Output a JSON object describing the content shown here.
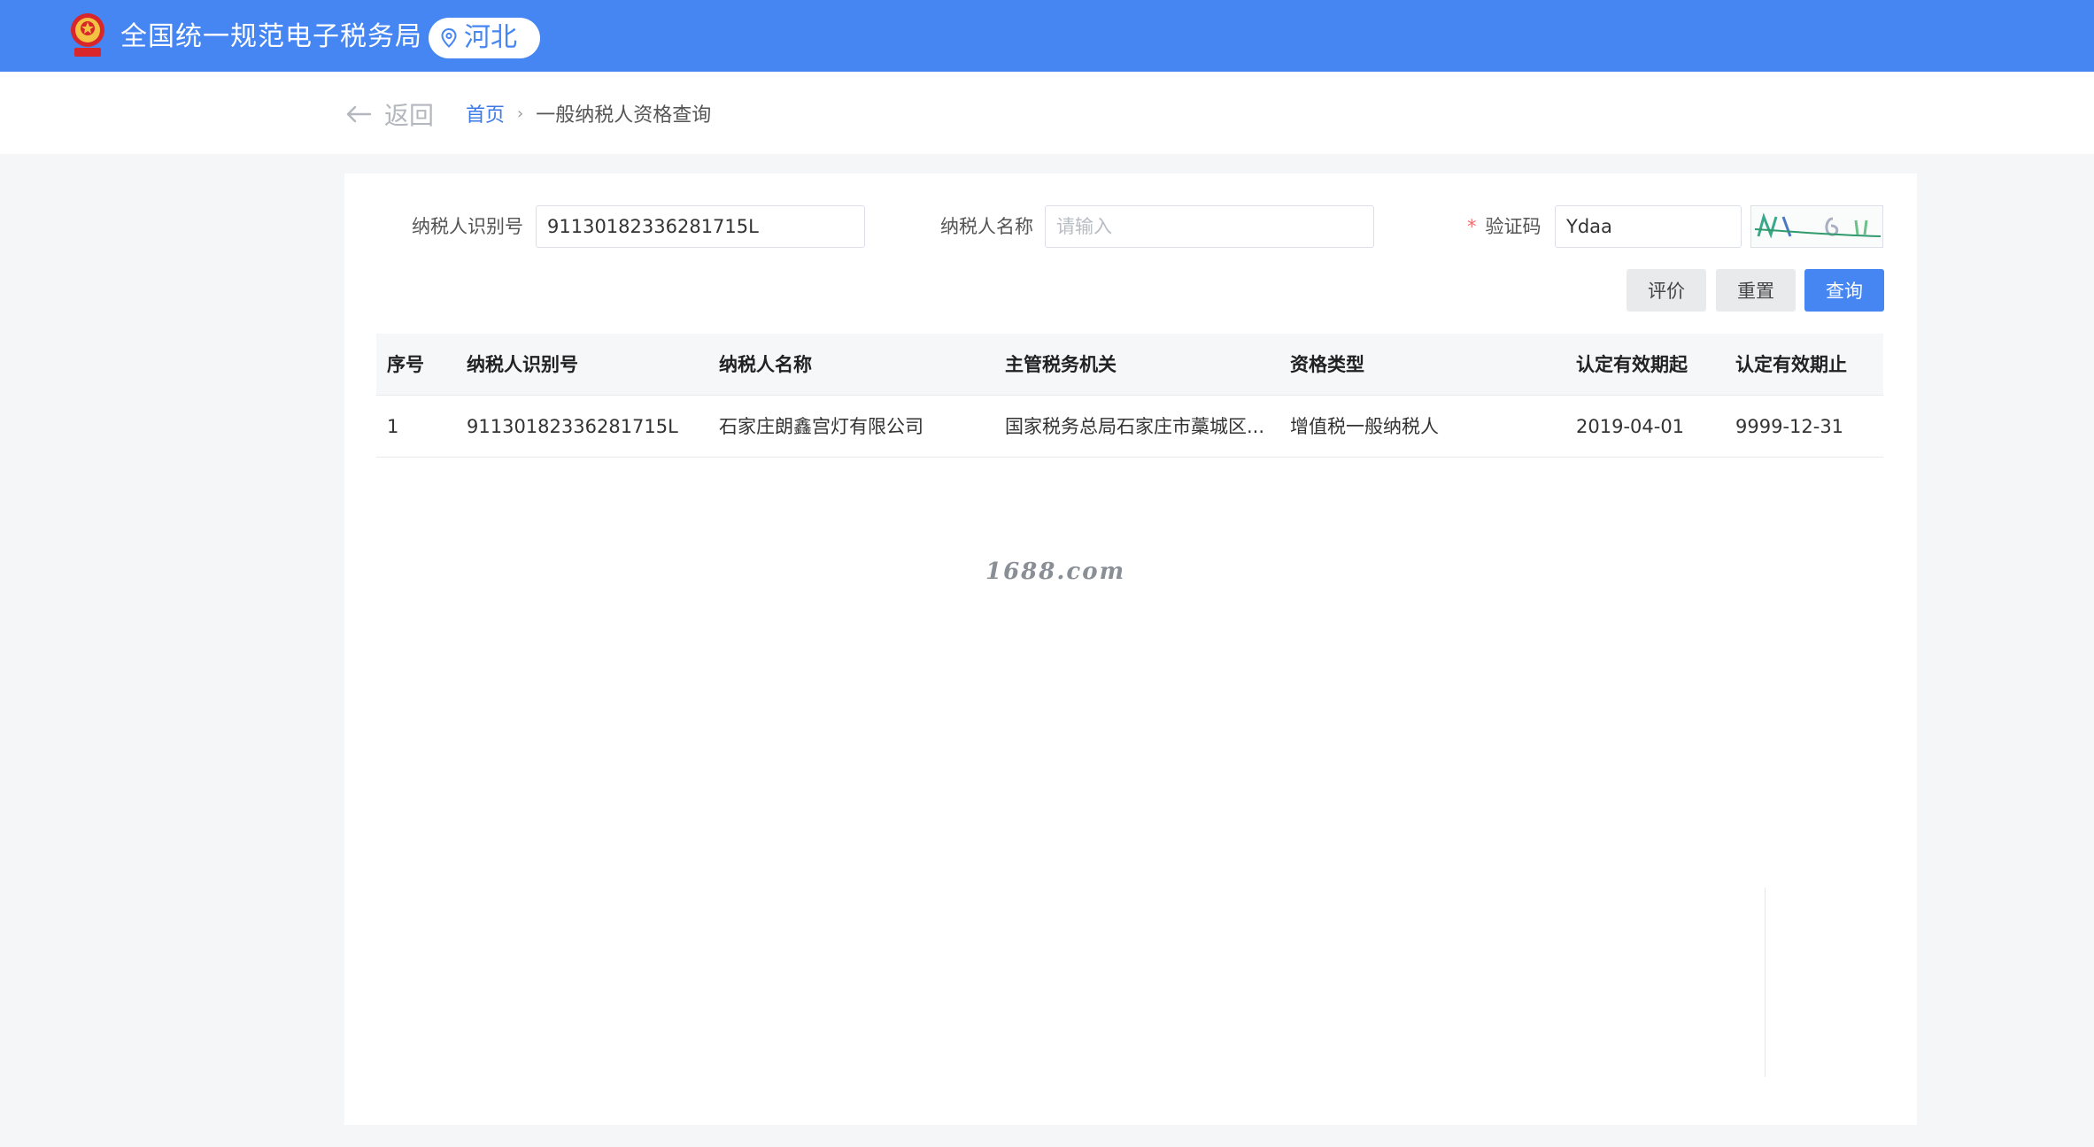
{
  "header": {
    "site_title": "全国统一规范电子税务局",
    "region": "河北",
    "emblem_icon": "national-emblem-icon",
    "brand_color": "#4586f3"
  },
  "nav": {
    "back_label": "返回",
    "breadcrumb_home": "首页",
    "breadcrumb_separator": "›",
    "breadcrumb_current": "一般纳税人资格查询"
  },
  "form": {
    "taxpayer_id_label": "纳税人识别号",
    "taxpayer_id_value": "91130182336281715L",
    "taxpayer_name_label": "纳税人名称",
    "taxpayer_name_placeholder": "请输入",
    "captcha_required_mark": "*",
    "captcha_label": "验证码",
    "captcha_value": "Ydaa"
  },
  "buttons": {
    "evaluate": "评价",
    "reset": "重置",
    "query": "查询"
  },
  "table": {
    "columns": [
      "序号",
      "纳税人识别号",
      "纳税人名称",
      "主管税务机关",
      "资格类型",
      "认定有效期起",
      "认定有效期止"
    ],
    "rows": [
      [
        "1",
        "91130182336281715L",
        "石家庄朗鑫宫灯有限公司",
        "国家税务总局石家庄市藁城区...",
        "增值税一般纳税人",
        "2019-04-01",
        "9999-12-31"
      ]
    ]
  },
  "watermark": "1688.com"
}
